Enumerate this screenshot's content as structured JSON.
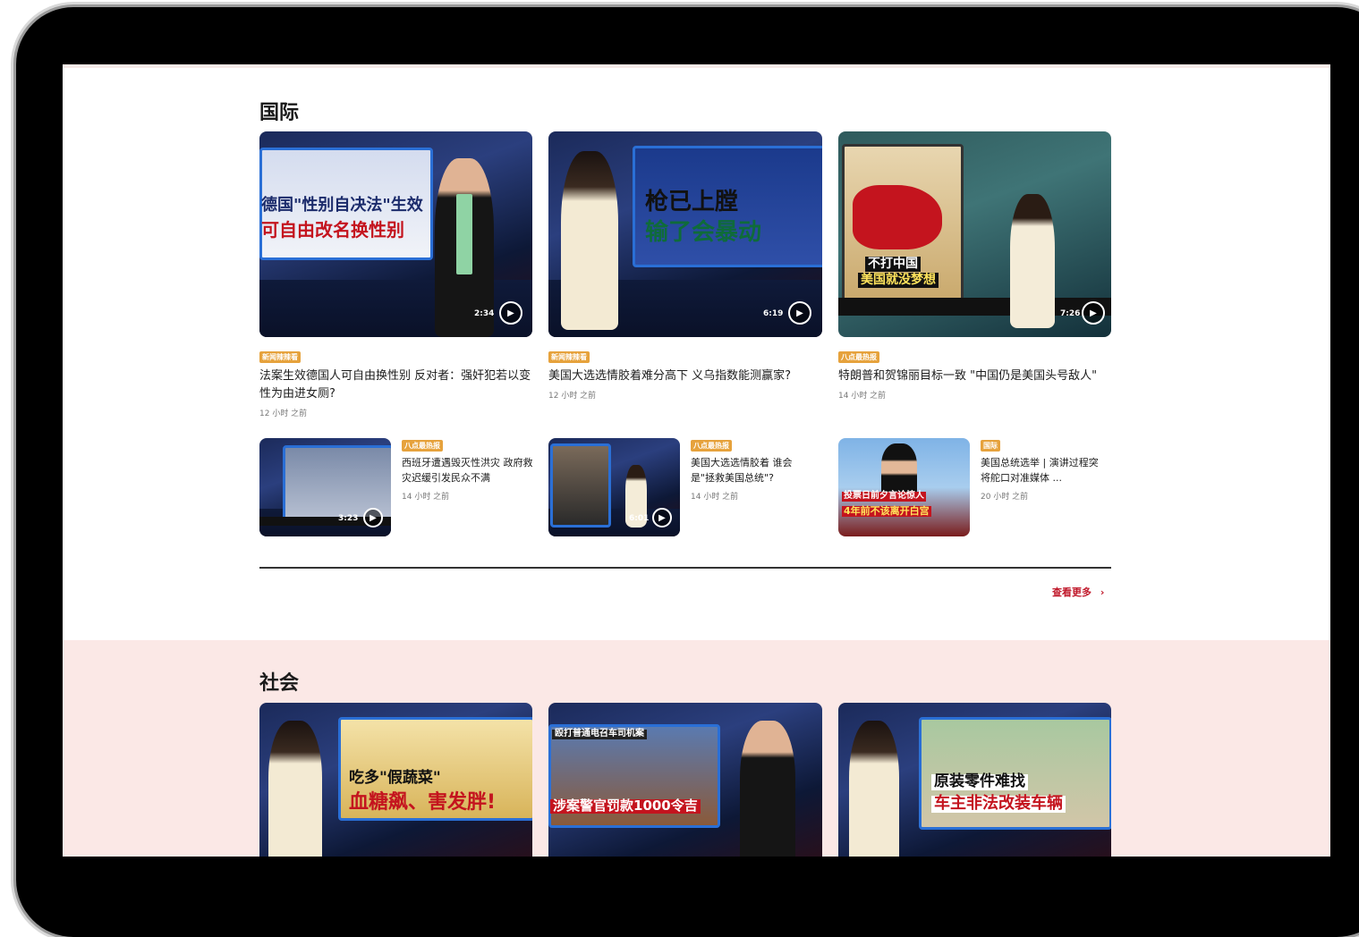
{
  "sections": {
    "international": {
      "title": "国际",
      "big_cards": [
        {
          "tag": "新闻辣辣看",
          "tag_color": "#e6a23c",
          "title": "法案生效德国人可自由换性别 反对者：强奸犯若以变性为由进女厕?",
          "time": "12 小时 之前",
          "duration": "2:34",
          "thumb_lines": [
            "德国\"性别自决法\"生效",
            "可自由改名换性别"
          ]
        },
        {
          "tag": "新闻辣辣看",
          "tag_color": "#e6a23c",
          "title": "美国大选选情胶着难分高下 义乌指数能测赢家?",
          "time": "12 小时 之前",
          "duration": "6:19",
          "thumb_lines": [
            "枪已上膛",
            "输了会暴动"
          ]
        },
        {
          "tag": "八点最热报",
          "tag_color": "#e6a23c",
          "title": "特朗普和贺锦丽目标一致 \"中国仍是美国头号敌人\"",
          "time": "14 小时 之前",
          "duration": "7:26",
          "thumb_lines": [
            "不打中国",
            "美国就没梦想"
          ]
        }
      ],
      "small_cards": [
        {
          "tag": "八点最热报",
          "tag_color": "#e6a23c",
          "title": "西班牙遭遇毁灭性洪灾 政府救灾迟缓引发民众不满",
          "time": "14 小时 之前",
          "duration": "3:23"
        },
        {
          "tag": "八点最热报",
          "tag_color": "#e6a23c",
          "title": "美国大选选情胶着 谁会是\"拯救美国总统\"?",
          "time": "14 小时 之前",
          "duration": "6:01"
        },
        {
          "tag": "国际",
          "tag_color": "#e6a23c",
          "title": "美国总统选举 | 演讲过程突将舵口对准媒体 ...",
          "time": "20 小时 之前",
          "thumb_lines": [
            "投票日前夕言论惊人",
            "4年前不该离开白宫"
          ]
        }
      ],
      "more_label": "查看更多"
    },
    "society": {
      "title": "社会",
      "cards": [
        {
          "thumb_lines": [
            "吃多\"假蔬菜\"",
            "血糖飙、害发胖!"
          ]
        },
        {
          "thumb_lines": [
            "殴打普通电召车司机案",
            "涉案警官罚款1000令吉"
          ]
        },
        {
          "thumb_lines": [
            "原装零件难找",
            "车主非法改装车辆"
          ]
        }
      ]
    }
  },
  "colors": {
    "accent_red": "#c0182a",
    "band_pink": "#fbe8e6",
    "tag_yellow": "#e6a23c"
  },
  "icons": [
    "play-icon",
    "chevron-right-icon"
  ]
}
